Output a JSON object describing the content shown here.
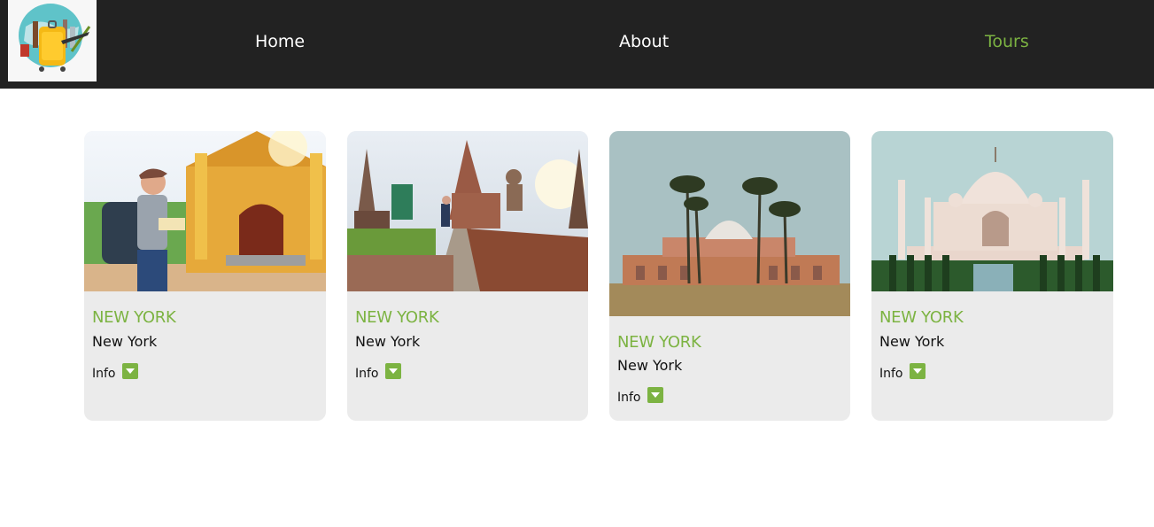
{
  "nav": {
    "logo_icon": "travel-globe-suitcase-logo",
    "links": [
      {
        "label": "Home",
        "active": false
      },
      {
        "label": "About",
        "active": false
      },
      {
        "label": "Tours",
        "active": true
      }
    ],
    "active_color": "#7cb342",
    "background": "#222222"
  },
  "tours": [
    {
      "image": "traveler-at-temple-photo",
      "title": "NEW YORK",
      "subtitle": "New York",
      "info_label": "Info",
      "toggle_icon": "caret-down-icon"
    },
    {
      "image": "ancient-temple-ruins-photo",
      "title": "NEW YORK",
      "subtitle": "New York",
      "info_label": "Info",
      "toggle_icon": "caret-down-icon"
    },
    {
      "image": "humayun-tomb-palms-photo",
      "title": "NEW YORK",
      "subtitle": "New York",
      "info_label": "Info",
      "toggle_icon": "caret-down-icon"
    },
    {
      "image": "taj-mahal-photo",
      "title": "NEW YORK",
      "subtitle": "New York",
      "info_label": "Info",
      "toggle_icon": "caret-down-icon"
    }
  ],
  "colors": {
    "accent": "#7cb342",
    "card_bg": "#ebebeb"
  }
}
